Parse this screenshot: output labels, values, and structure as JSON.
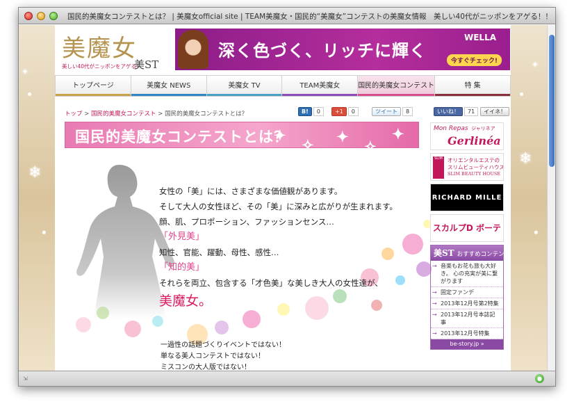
{
  "window": {
    "title": "国民的美魔女コンテストとは？ | 美魔女official site | TEAM美魔女・国民的“美魔女”コンテストの美魔女情報　美しい40代がニッポンをアゲる！！ [bimajo.jp]"
  },
  "header": {
    "logo_text": "美魔女",
    "logo_tagline": "美しい40代がニッポンをアゲる！",
    "logo_st": "美ST"
  },
  "banner": {
    "text": "深く色づく、リッチに輝く",
    "brand": "WELLA",
    "cta": "今すぐチェック!"
  },
  "nav": {
    "items": [
      {
        "label": "トップページ"
      },
      {
        "label": "美魔女 NEWS"
      },
      {
        "label": "美魔女 TV"
      },
      {
        "label": "TEAM美魔女"
      },
      {
        "label": "国民的美魔女コンテスト"
      },
      {
        "label": "特 集"
      }
    ]
  },
  "breadcrumb": {
    "home": "トップ",
    "sep1": " > ",
    "section": "国民的美魔女コンテスト",
    "sep2": " > ",
    "current": "国民的美魔女コンテストとは？"
  },
  "social": {
    "hatena_label": "B!",
    "hatena_count": "0",
    "gplus_label": "+1",
    "gplus_count": "0",
    "tweet_label": "ツイート",
    "tweet_count": "8",
    "fb_like_label": "いいね！",
    "fb_like_count": "71",
    "mixi_label": "イイネ！"
  },
  "main": {
    "title": "国民的美魔女コンテストとは？",
    "lines": [
      "女性の「美」には、さまざまな価値観があります。",
      "そして大人の女性ほど、その「美」に深みと広がりが生まれます。",
      "顔、肌、プロポーション、ファッションセンス…",
      "「外見美」",
      "知性、官能、躍動、母性、感性…",
      "「知的美」",
      "それらを両立、包含する「才色美」な美しき大人の女性達が、",
      "美魔女。"
    ],
    "small_lines": [
      "一過性の話題づくりイベントではない！",
      "単なる美人コンテストではない！",
      "ミスコンの大人版ではない！"
    ]
  },
  "sidebar": {
    "gerlinea_1": "Mon Repas",
    "gerlinea_2": "ジャリネア",
    "gerlinea_3": "Gerlinéa",
    "slim_logo": "SLIM",
    "slim_1": "オリエンタルエステの",
    "slim_2": "スリムビューティハウス",
    "slim_3": "SLIM BEAUTY HOUSE",
    "richard": "RICHARD MILLE",
    "scalp": "スカルプD ボーテ",
    "rec_logo": "美ST",
    "rec_title": "おすすめコンテンツ",
    "rec_items": [
      "音楽もお花も旅も大好き。 心の充実が美に繋がります",
      "固定ファンデ",
      "2013年12月号第2特集",
      "2013年12月号本誌記事",
      "2013年12月号特集"
    ],
    "rec_footer": "be-story.jp »"
  },
  "colors": {
    "accent_pink": "#d81b60",
    "nav_active": "#f1cadb",
    "sidebar_purple": "#8a4aa4"
  }
}
